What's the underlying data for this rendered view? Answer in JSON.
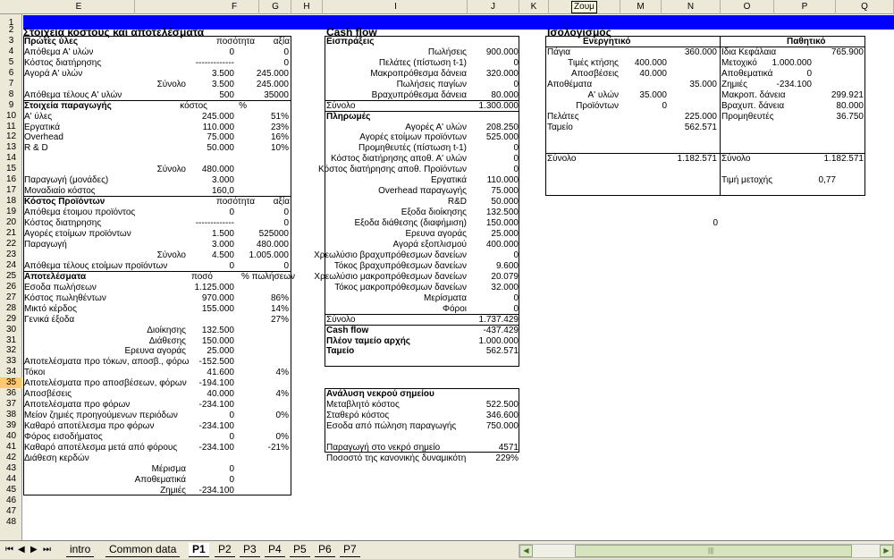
{
  "columns": [
    "E",
    "F",
    "G",
    "H",
    "I",
    "J",
    "K",
    "L",
    "M",
    "N",
    "O",
    "P",
    "Q"
  ],
  "zoom_tooltip": "Ζουμ",
  "rows": [
    "1",
    "2",
    "3",
    "4",
    "5",
    "6",
    "7",
    "8",
    "9",
    "10",
    "11",
    "12",
    "13",
    "14",
    "15",
    "16",
    "17",
    "18",
    "19",
    "20",
    "21",
    "22",
    "23",
    "24",
    "25",
    "26",
    "27",
    "28",
    "29",
    "30",
    "31",
    "32",
    "33",
    "34",
    "35",
    "36",
    "37",
    "38",
    "39",
    "40",
    "41",
    "42",
    "43",
    "44",
    "45",
    "46",
    "47",
    "48"
  ],
  "costs": {
    "title": "Στοιχεία κόστους και αποτελέσματα",
    "raw_materials": {
      "header": "Πρώτες ύλες",
      "qty_h": "ποσότητα",
      "val_h": "αξία",
      "rows": [
        [
          "Απόθεμα Α' υλών",
          "0",
          "0"
        ],
        [
          "Κόστος διατήρησης",
          "-------------",
          "0"
        ],
        [
          "Αγορά Α' υλών",
          "3.500",
          "245.000"
        ],
        [
          "Σύνολο",
          "3.500",
          "245.000"
        ],
        [
          "Απόθεμα τέλους Α' υλών",
          "500",
          "35000"
        ]
      ]
    },
    "production": {
      "header": "Στοιχεία παραγωγής",
      "cost_h": "κόστος",
      "pct_h": "%",
      "rows": [
        [
          "Α' ύλες",
          "245.000",
          "51%"
        ],
        [
          "Εργατικά",
          "110.000",
          "23%"
        ],
        [
          "Overhead",
          "75.000",
          "16%"
        ],
        [
          "R & D",
          "50.000",
          "10%"
        ]
      ],
      "total_label": "Σύνολο",
      "total": "480.000",
      "units_label": "Παραγωγή (μονάδες)",
      "units": "3.000",
      "unit_cost_label": "Μοναδιαίο κόστος",
      "unit_cost": "160,0"
    },
    "product_costs": {
      "header": "Κόστος Προϊόντων",
      "qty_h": "ποσότητα",
      "val_h": "αξία",
      "rows": [
        [
          "Απόθεμα έτοιμου προϊόντος",
          "0",
          "0"
        ],
        [
          "Κόστος διατηρησης",
          "-------------",
          "0"
        ],
        [
          "Αγορές ετοίμων προϊόντων",
          "1.500",
          "525000"
        ],
        [
          "Παραγωγή",
          "3.000",
          "480.000"
        ],
        [
          "Σύνολο",
          "4.500",
          "1.005.000"
        ],
        [
          "Απόθεμα τέλους ετοίμων προϊόντων",
          "0",
          "0"
        ]
      ]
    },
    "results": {
      "header": "Αποτελέσματα",
      "amt_h": "ποσό",
      "pct_h": "% πωλήσεων",
      "rows": [
        [
          "Εσοδα πωλήσεων",
          "1.125.000",
          ""
        ],
        [
          "Κόστος πωληθέντων",
          "970.000",
          "86%"
        ],
        [
          "Μικτό κέρδος",
          "155.000",
          "14%"
        ],
        [
          "Γενικά έξοδα",
          "",
          "27%"
        ]
      ],
      "sub": [
        [
          "Διοίκησης",
          "132.500"
        ],
        [
          "Διάθεσης",
          "150.000"
        ],
        [
          "Ερευνα αγοράς",
          "25.000"
        ]
      ],
      "rows2": [
        [
          "Αποτελέσματα προ τόκων, αποσβ., φόρω",
          "-152.500",
          ""
        ],
        [
          "Τόκοι",
          "41.600",
          "4%"
        ],
        [
          "Αποτελέσματα προ αποσβέσεων, φόρων",
          "-194.100",
          ""
        ],
        [
          "Αποσβέσεις",
          "40.000",
          "4%"
        ],
        [
          "Αποτελέσματα προ φόρων",
          "-234.100",
          ""
        ],
        [
          "Μείον ζημιές προηγούμενων περιόδων",
          "0",
          "0%"
        ],
        [
          "Καθαρό αποτέλεσμα προ φόρων",
          "-234.100",
          ""
        ],
        [
          "Φόρος εισοδήματος",
          "0",
          "0%"
        ],
        [
          "Καθαρό αποτέλεσμα μετά από φόρους",
          "-234.100",
          "-21%"
        ]
      ],
      "dist_label": "Διάθεση κερδών",
      "dist": [
        [
          "Μέρισμα",
          "0"
        ],
        [
          "Αποθεματικά",
          "0"
        ],
        [
          "Ζημιές",
          "-234.100"
        ]
      ]
    }
  },
  "cashflow": {
    "title": "Cash flow",
    "in_header": "Εισπράξεις",
    "inflows": [
      [
        "Πωλήσεις",
        "900.000"
      ],
      [
        "Πελάτες (πίστωση t-1)",
        "0"
      ],
      [
        "Μακροπρόθεσμα δάνεια",
        "320.000"
      ],
      [
        "Πωλήσεις παγίων",
        "0"
      ],
      [
        "Βραχυπρόθεσμα δάνεια",
        "80.000"
      ]
    ],
    "in_total": [
      "Σύνολο",
      "1.300.000"
    ],
    "out_header": "Πληρωμές",
    "outflows": [
      [
        "Αγορές Α' υλών",
        "208.250"
      ],
      [
        "Αγορές ετοίμων προϊόντων",
        "525.000"
      ],
      [
        "Προμηθευτές (πίστωση t-1)",
        "0"
      ],
      [
        "Κόστος διατήρησης αποθ. Α' υλών",
        "0"
      ],
      [
        "Κόστος διατήρησης αποθ. Προϊόντων",
        "0"
      ],
      [
        "Εργατικά",
        "110.000"
      ],
      [
        "Overhead παραγωγής",
        "75.000"
      ],
      [
        "R&D",
        "50.000"
      ],
      [
        "Εξοδα διοίκησης",
        "132.500"
      ],
      [
        "Εξοδα διάθεσης (διαφήμιση)",
        "150.000"
      ],
      [
        "Ερευνα αγοράς",
        "25.000"
      ],
      [
        "Αγορά εξοπλισμού",
        "400.000"
      ],
      [
        "Χρεωλύσιο βραχυπρόθεσμων δανείων",
        "0"
      ],
      [
        "Τόκος βραχυπρόθεσμων δανείων",
        "9.600"
      ],
      [
        "Χρεωλύσιο μακροπρόθεσμων δανείων",
        "20.079"
      ],
      [
        "Τόκος μακροπρόθεσμων δανείων",
        "32.000"
      ],
      [
        "Μερίσματα",
        "0"
      ],
      [
        "Φόροι",
        "0"
      ]
    ],
    "out_total": [
      "Σύνολο",
      "1.737.429"
    ],
    "cf": [
      "Cash flow",
      "-437.429"
    ],
    "start": [
      "Πλέον ταμείο αρχής",
      "1.000.000"
    ],
    "cash": [
      "Ταμείο",
      "562.571"
    ]
  },
  "breakeven": {
    "title": "Ανάλυση νεκρού σημείου",
    "rows": [
      [
        "Μεταβλητό κόστος",
        "522.500"
      ],
      [
        "Σταθερό κόστος",
        "346.600"
      ],
      [
        "Εσοδα από πώληση παραγωγής",
        "750.000"
      ]
    ],
    "rows2": [
      [
        "Παραγωγή στο νεκρό σημείο",
        "4571"
      ],
      [
        "Ποσοστό της κανονικής δυναμικότη",
        "229%"
      ]
    ]
  },
  "stray_zero": "0",
  "balance": {
    "title": "Ισολογισμός",
    "assets_h": "Ενεργητικό",
    "liab_h": "Παθητικό",
    "fixed": [
      "Πάγια",
      "360.000"
    ],
    "fixed_sub": [
      [
        "Τιμές κτήσης",
        "400.000"
      ],
      [
        "Αποσβέσεις",
        "40.000"
      ]
    ],
    "inv": [
      "Αποθέματα",
      "35.000"
    ],
    "inv_sub": [
      [
        "Α' υλών",
        "35.000"
      ],
      [
        "Προϊόντων",
        "0"
      ]
    ],
    "clients": [
      "Πελάτες",
      "225.000"
    ],
    "cashbox": [
      "Ταμείο",
      "562.571"
    ],
    "a_total": [
      "Σύνολο",
      "1.182.571"
    ],
    "equity": [
      "Ιδια Κεφάλαια",
      "765.900"
    ],
    "eq_sub": [
      [
        "Μετοχικό",
        "1.000.000"
      ],
      [
        "Αποθεματικά",
        "0"
      ],
      [
        "Ζημιές",
        "-234.100"
      ]
    ],
    "liab": [
      [
        "Μακροπ. δάνεια",
        "299.921"
      ],
      [
        "Βραχυπ. δάνεια",
        "80.000"
      ],
      [
        "Προμηθευτές",
        "36.750"
      ]
    ],
    "l_total": [
      "Σύνολο",
      "1.182.571"
    ],
    "share": [
      "Τιμή μετοχής",
      "0,77"
    ]
  },
  "tabs": {
    "nav": [
      "⏮",
      "◀",
      "▶",
      "⏭"
    ],
    "items": [
      "intro",
      "Common data",
      "P1",
      "P2",
      "P3",
      "P4",
      "P5",
      "P6",
      "P7"
    ],
    "active": "P1"
  },
  "scroll": {
    "left": "◀",
    "grip": "|||",
    "right": "▶"
  }
}
